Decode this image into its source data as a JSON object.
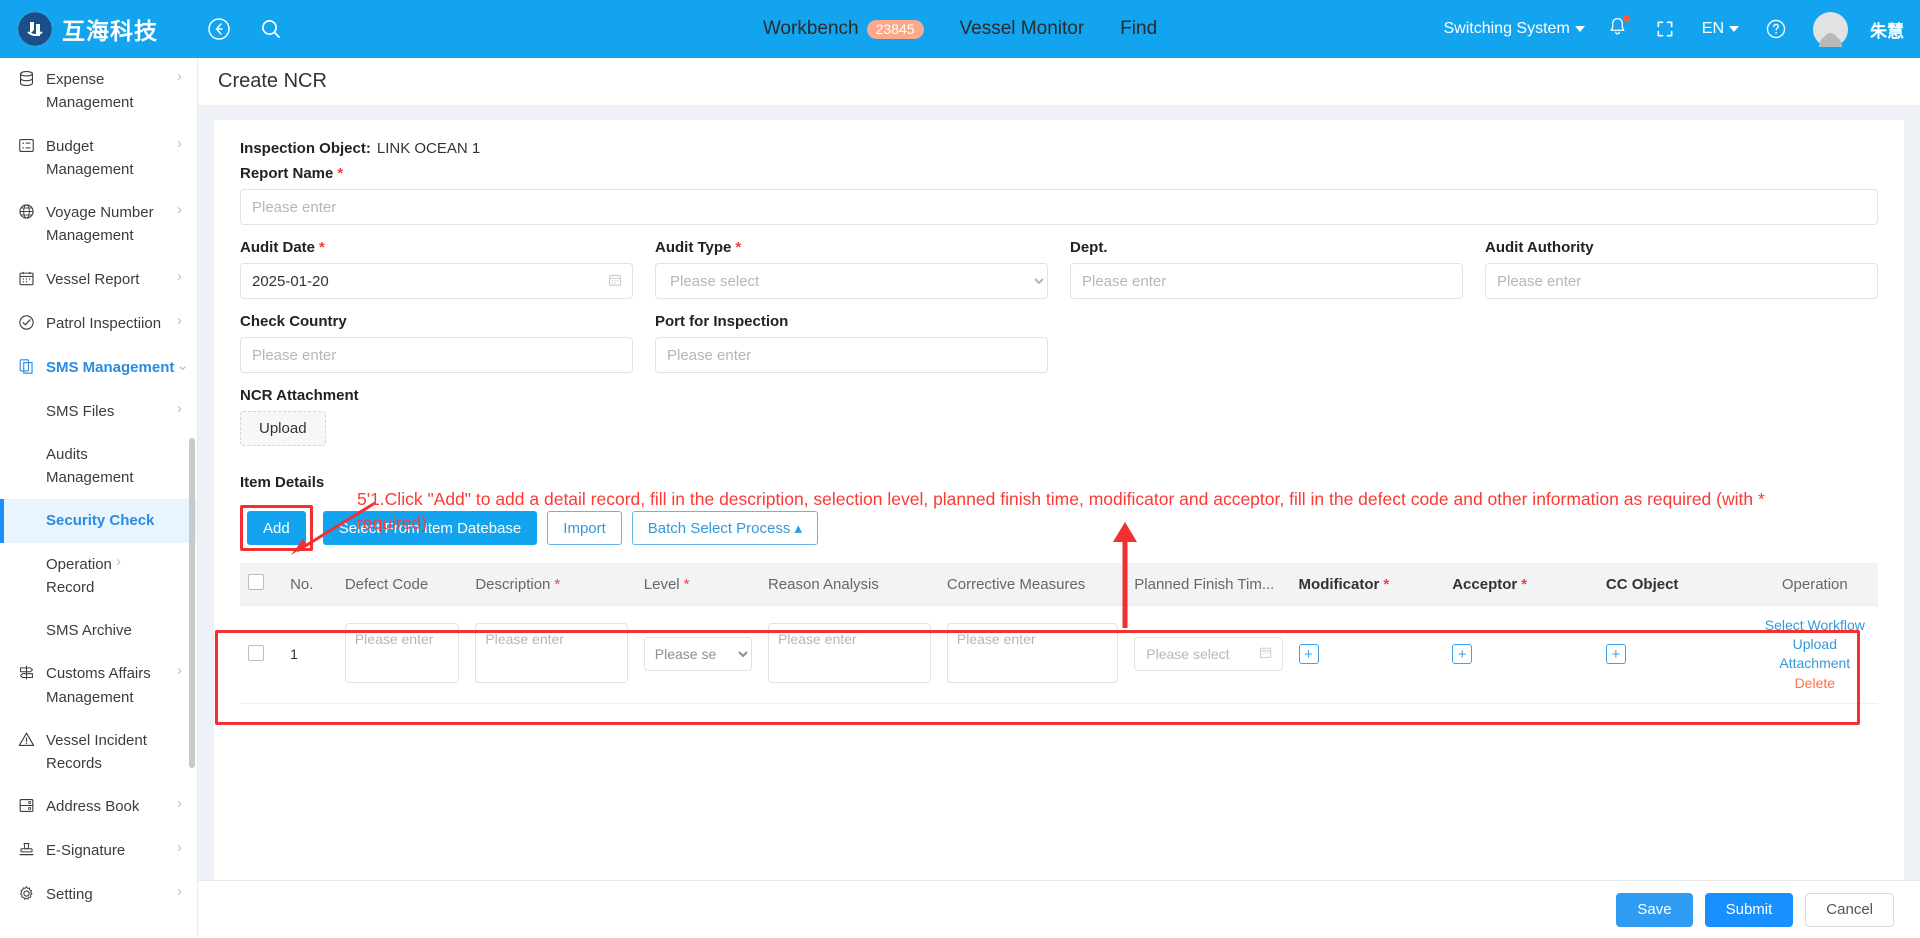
{
  "header": {
    "brand_name": "互海科技",
    "back_icon": "back-arrow-icon",
    "search_icon": "search-icon",
    "nav": [
      {
        "label": "Workbench",
        "badge": "23845"
      },
      {
        "label": "Vessel Monitor",
        "badge": ""
      },
      {
        "label": "Find",
        "badge": ""
      }
    ],
    "switching_system": "Switching System",
    "language": "EN",
    "username": "朱慧",
    "bell_icon": "bell-icon",
    "fullscreen_icon": "fullscreen-icon",
    "help_icon": "help-circle-icon"
  },
  "sidebar": {
    "items": [
      {
        "label": "Expense Management",
        "icon": "database-icon",
        "chevron": "›",
        "level": "top",
        "state": ""
      },
      {
        "label": "Budget Management",
        "icon": "budget-grid-icon",
        "chevron": "›",
        "level": "top",
        "state": ""
      },
      {
        "label": "Voyage Number Management",
        "icon": "globe-icon",
        "chevron": "›",
        "level": "top",
        "state": ""
      },
      {
        "label": "Vessel Report",
        "icon": "calendar-icon",
        "chevron": "›",
        "level": "top",
        "state": ""
      },
      {
        "label": "Patrol Inspectiion",
        "icon": "check-circle-icon",
        "chevron": "›",
        "level": "top",
        "state": ""
      },
      {
        "label": "SMS Management",
        "icon": "documents-icon",
        "chevron": "⌄",
        "level": "top",
        "state": "open"
      },
      {
        "label": "SMS Files",
        "icon": "",
        "chevron": "›",
        "level": "sub",
        "state": ""
      },
      {
        "label": "Audits Management",
        "icon": "",
        "chevron": "",
        "level": "sub",
        "state": ""
      },
      {
        "label": "Security Check",
        "icon": "",
        "chevron": "",
        "level": "sub",
        "state": "active"
      },
      {
        "label": "Operation Record",
        "icon": "",
        "chevron": "›",
        "level": "sub",
        "state": ""
      },
      {
        "label": "SMS Archive",
        "icon": "",
        "chevron": "",
        "level": "sub",
        "state": ""
      },
      {
        "label": "Customs Affairs Management",
        "icon": "signpost-icon",
        "chevron": "›",
        "level": "top",
        "state": ""
      },
      {
        "label": "Vessel Incident Records",
        "icon": "warning-triangle-icon",
        "chevron": "",
        "level": "top",
        "state": ""
      },
      {
        "label": "Address Book",
        "icon": "addressbook-icon",
        "chevron": "›",
        "level": "top",
        "state": ""
      },
      {
        "label": "E-Signature",
        "icon": "stamp-icon",
        "chevron": "›",
        "level": "top",
        "state": ""
      },
      {
        "label": "Setting",
        "icon": "gear-icon",
        "chevron": "›",
        "level": "top",
        "state": ""
      }
    ]
  },
  "page": {
    "title": "Create NCR",
    "inspection_object_label": "Inspection Object:",
    "inspection_object_value": "LINK OCEAN 1"
  },
  "form": {
    "report_name": {
      "label": "Report Name",
      "required": true,
      "value": "",
      "placeholder": "Please enter"
    },
    "audit_date": {
      "label": "Audit Date",
      "required": true,
      "value": "2025-01-20",
      "placeholder": ""
    },
    "audit_type": {
      "label": "Audit Type",
      "required": true,
      "value": "Please select",
      "options": [
        "Please select"
      ]
    },
    "dept": {
      "label": "Dept.",
      "required": false,
      "value": "",
      "placeholder": "Please enter"
    },
    "audit_authority": {
      "label": "Audit Authority",
      "required": false,
      "value": "",
      "placeholder": "Please enter"
    },
    "check_country": {
      "label": "Check Country",
      "required": false,
      "value": "",
      "placeholder": "Please enter"
    },
    "port_for_inspection": {
      "label": "Port for Inspection",
      "required": false,
      "value": "",
      "placeholder": "Please enter"
    },
    "ncr_attachment": {
      "label": "NCR Attachment",
      "upload_label": "Upload"
    }
  },
  "item_details": {
    "title": "Item Details",
    "buttons": [
      {
        "label": "Add",
        "style": "primary",
        "highlighted": true
      },
      {
        "label": "Select From Item Datebase",
        "style": "primary",
        "highlighted": false
      },
      {
        "label": "Import",
        "style": "outline",
        "highlighted": false
      },
      {
        "label": "Batch Select Process ▴",
        "style": "outline",
        "highlighted": false
      }
    ],
    "columns": [
      {
        "label": "",
        "required": false,
        "bold": false
      },
      {
        "label": "No.",
        "required": false,
        "bold": false
      },
      {
        "label": "Defect Code",
        "required": false,
        "bold": false
      },
      {
        "label": "Description",
        "required": true,
        "bold": false
      },
      {
        "label": "Level",
        "required": true,
        "bold": false
      },
      {
        "label": "Reason Analysis",
        "required": false,
        "bold": false
      },
      {
        "label": "Corrective Measures",
        "required": false,
        "bold": false
      },
      {
        "label": "Planned Finish Tim...",
        "required": false,
        "bold": false
      },
      {
        "label": "Modificator",
        "required": true,
        "bold": true
      },
      {
        "label": "Acceptor",
        "required": true,
        "bold": true
      },
      {
        "label": "CC Object",
        "required": false,
        "bold": true
      },
      {
        "label": "Operation",
        "required": false,
        "bold": false
      }
    ],
    "rows": [
      {
        "no": "1",
        "defect_code": {
          "value": "",
          "placeholder": "Please enter"
        },
        "description": {
          "value": "",
          "placeholder": "Please enter"
        },
        "level": {
          "value": "Please se",
          "options": [
            "Please se"
          ]
        },
        "reason_analysis": {
          "value": "",
          "placeholder": "Please enter"
        },
        "corrective_measures": {
          "value": "",
          "placeholder": "Please enter"
        },
        "planned_finish_time": {
          "value": "",
          "placeholder": "Please select"
        },
        "modificator": {
          "icon": "plus-icon"
        },
        "acceptor": {
          "icon": "plus-icon"
        },
        "cc_object": {
          "icon": "plus-icon"
        },
        "operation": {
          "select_workflow": "Select Workflow",
          "upload_attachment": "Upload Attachment",
          "delete": "Delete"
        }
      }
    ]
  },
  "annotation": {
    "text": "5'1.Click \"Add\" to add a detail record, fill in the description, selection level, planned finish time, modificator and acceptor, fill in the defect code and other information as required (with * required)",
    "color": "#fb3a35"
  },
  "footer": {
    "save": "Save",
    "submit": "Submit",
    "cancel": "Cancel"
  },
  "colors": {
    "brand_blue": "#12A4EF",
    "accent_blue": "#1890ff",
    "annotation_red": "#f23030",
    "required_red": "#f04134",
    "badge_orange": "#FBA98A"
  }
}
